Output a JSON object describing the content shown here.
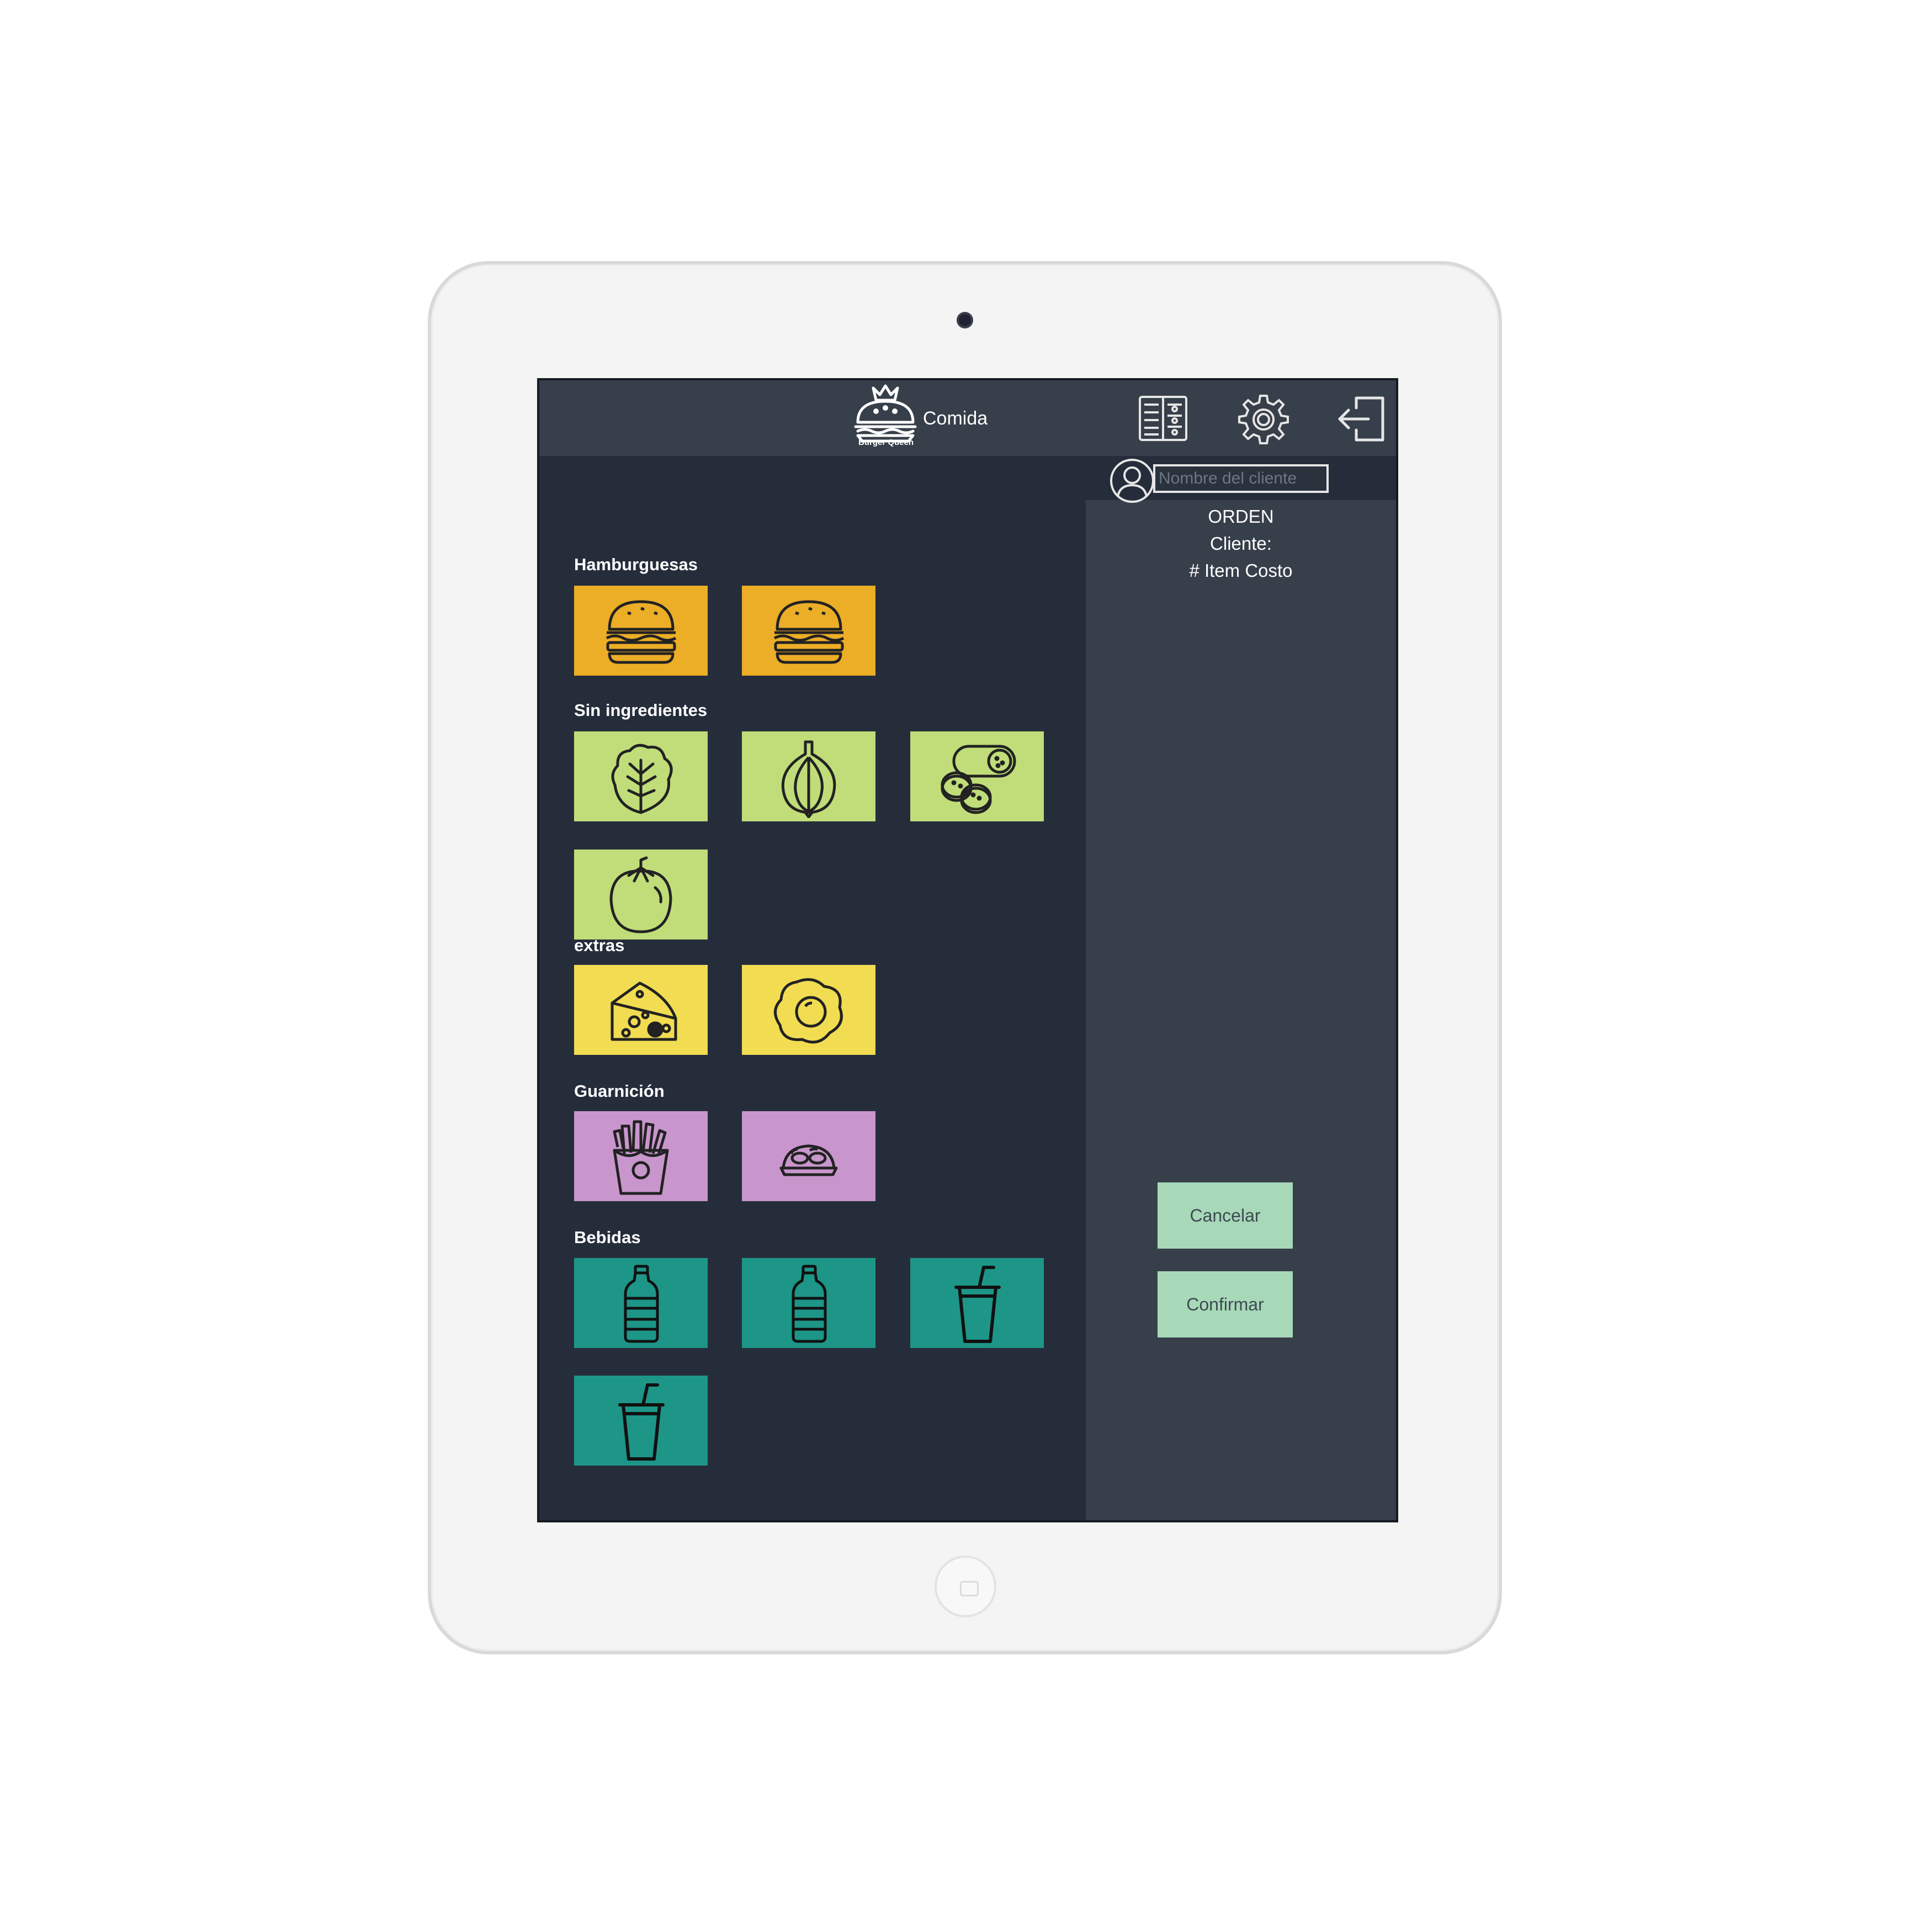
{
  "header": {
    "logo_text": "Burger Queen",
    "title": "Comida",
    "icons": [
      "menu-book-icon",
      "gear-icon",
      "logout-icon"
    ]
  },
  "client": {
    "placeholder": "Nombre del cliente"
  },
  "order": {
    "heading": "ORDEN",
    "client_label": "Cliente:",
    "columns": "# Item Costo"
  },
  "sections": {
    "hamburguesas": "Hamburguesas",
    "sin_ingredientes": "Sin ingredientes",
    "extras": "extras",
    "guarnicion": "Guarnición",
    "bebidas": "Bebidas"
  },
  "tiles": {
    "hamburguesas": [
      "burger-icon",
      "burger-icon"
    ],
    "sin_ingredientes": [
      "lettuce-icon",
      "onion-icon",
      "cucumber-icon",
      "tomato-icon"
    ],
    "extras": [
      "cheese-icon",
      "fried-egg-icon"
    ],
    "guarnicion": [
      "french-fries-icon",
      "onion-rings-icon"
    ],
    "bebidas": [
      "water-bottle-icon",
      "water-bottle-icon",
      "soda-cup-icon",
      "soda-cup-icon"
    ]
  },
  "buttons": {
    "cancel": "Cancelar",
    "confirm": "Confirmar"
  },
  "colors": {
    "screen_bg": "#252d3b",
    "panel_bg": "#373f4a",
    "burger_tile": "#ecad27",
    "ingredient_tile": "#c0dd79",
    "extra_tile": "#f1dc52",
    "side_tile": "#c896cc",
    "drink_tile": "#1d9688",
    "action_button": "#a7d9b8"
  }
}
